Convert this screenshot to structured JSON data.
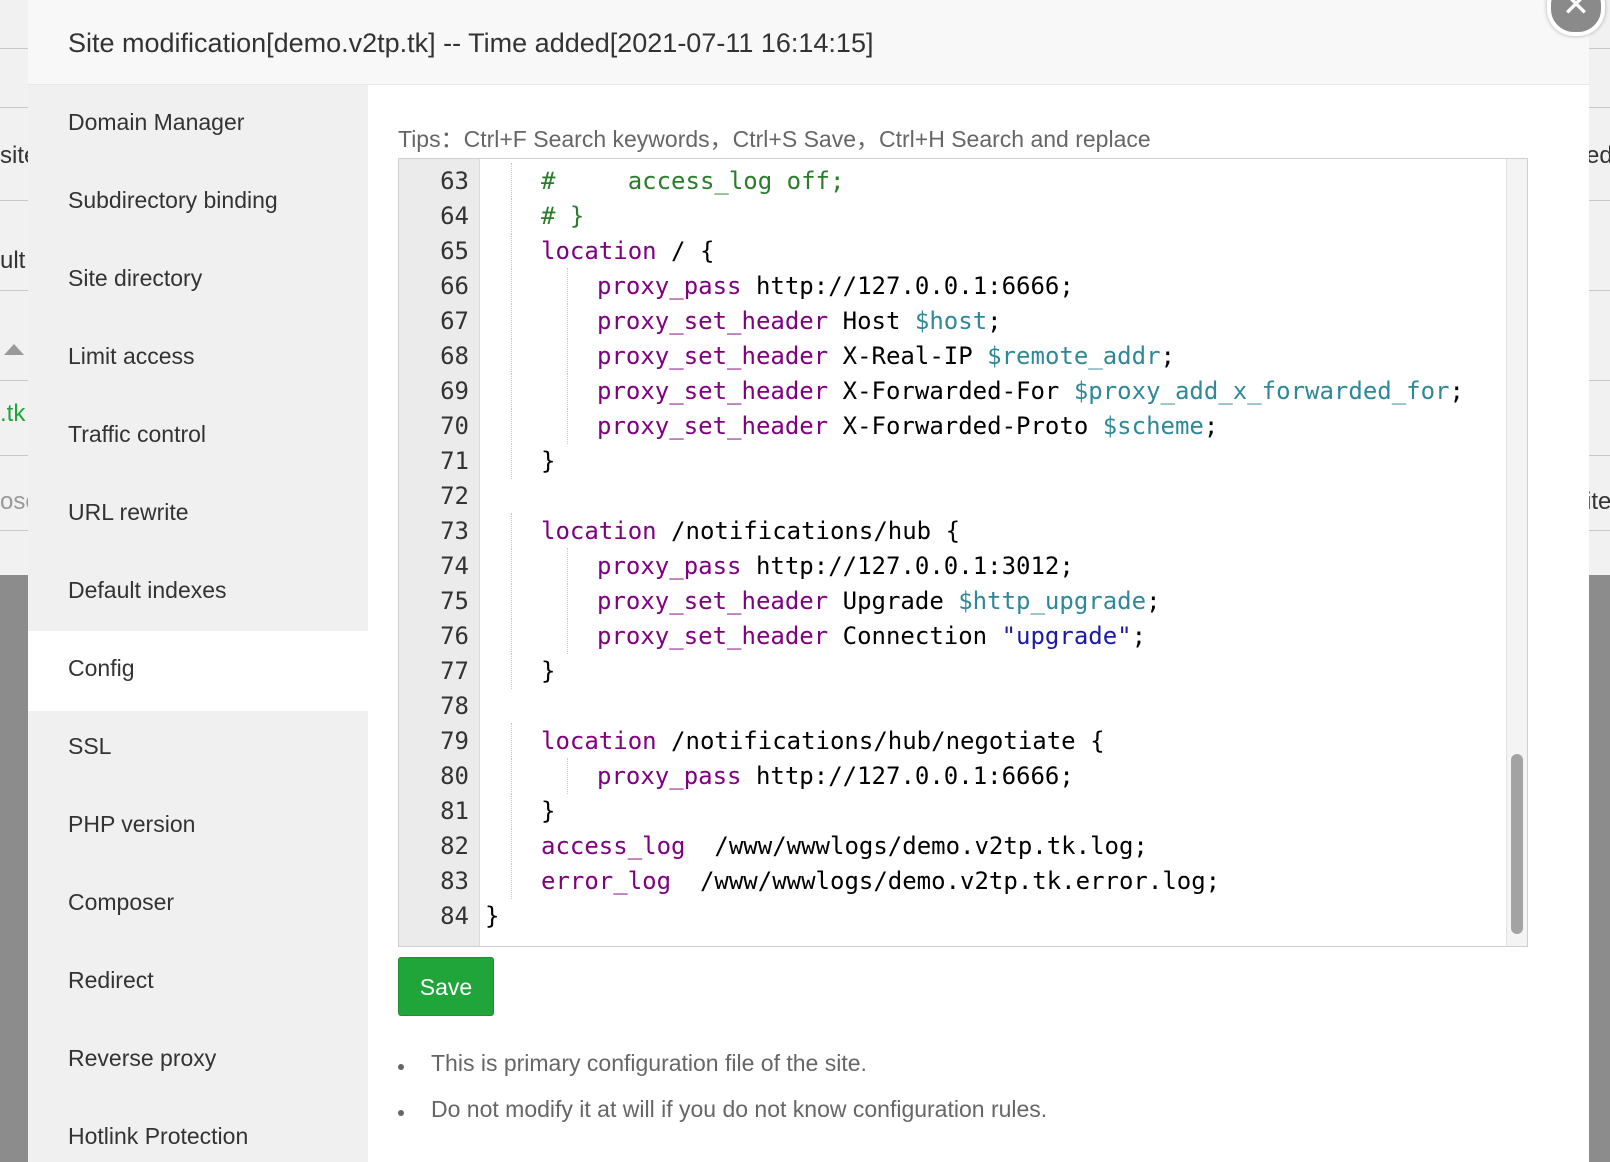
{
  "background": {
    "left_fragments": [
      "site",
      "ult",
      ".tk",
      "ose"
    ],
    "right_fragments": [
      "ed",
      "ite"
    ]
  },
  "modal": {
    "title": "Site modification[demo.v2tp.tk] -- Time added[2021-07-11 16:14:15]",
    "close_icon": "close-icon"
  },
  "sidebar": {
    "items": [
      {
        "label": "Domain Manager"
      },
      {
        "label": "Subdirectory binding"
      },
      {
        "label": "Site directory"
      },
      {
        "label": "Limit access"
      },
      {
        "label": "Traffic control"
      },
      {
        "label": "URL rewrite"
      },
      {
        "label": "Default indexes"
      },
      {
        "label": "Config"
      },
      {
        "label": "SSL"
      },
      {
        "label": "PHP version"
      },
      {
        "label": "Composer"
      },
      {
        "label": "Redirect"
      },
      {
        "label": "Reverse proxy"
      },
      {
        "label": "Hotlink Protection"
      }
    ],
    "active": "Config"
  },
  "tips": "Tips：Ctrl+F Search keywords，Ctrl+S Save，Ctrl+H Search and replace",
  "editor": {
    "lines": [
      {
        "n": "63",
        "indent": 1,
        "tokens": [
          [
            "cm",
            "#     access_log off;"
          ]
        ]
      },
      {
        "n": "64",
        "indent": 1,
        "tokens": [
          [
            "cm",
            "# }"
          ]
        ]
      },
      {
        "n": "65",
        "indent": 1,
        "tokens": [
          [
            "kw",
            "location"
          ],
          [
            "",
            " / {"
          ]
        ]
      },
      {
        "n": "66",
        "indent": 2,
        "tokens": [
          [
            "kw",
            "proxy_pass"
          ],
          [
            "",
            " http://127.0.0.1:6666;"
          ]
        ]
      },
      {
        "n": "67",
        "indent": 2,
        "tokens": [
          [
            "kw",
            "proxy_set_header"
          ],
          [
            "",
            " Host "
          ],
          [
            "var",
            "$host"
          ],
          [
            "",
            ";"
          ]
        ]
      },
      {
        "n": "68",
        "indent": 2,
        "tokens": [
          [
            "kw",
            "proxy_set_header"
          ],
          [
            "",
            " X-Real-IP "
          ],
          [
            "var",
            "$remote_addr"
          ],
          [
            "",
            ";"
          ]
        ]
      },
      {
        "n": "69",
        "indent": 2,
        "tokens": [
          [
            "kw",
            "proxy_set_header"
          ],
          [
            "",
            " X-Forwarded-For "
          ],
          [
            "var",
            "$proxy_add_x_forwarded_for"
          ],
          [
            "",
            ";"
          ]
        ]
      },
      {
        "n": "70",
        "indent": 2,
        "tokens": [
          [
            "kw",
            "proxy_set_header"
          ],
          [
            "",
            " X-Forwarded-Proto "
          ],
          [
            "var",
            "$scheme"
          ],
          [
            "",
            ";"
          ]
        ]
      },
      {
        "n": "71",
        "indent": 1,
        "tokens": [
          [
            "",
            "}"
          ]
        ]
      },
      {
        "n": "72",
        "indent": 0,
        "tokens": []
      },
      {
        "n": "73",
        "indent": 1,
        "tokens": [
          [
            "kw",
            "location"
          ],
          [
            "",
            " /notifications/hub {"
          ]
        ]
      },
      {
        "n": "74",
        "indent": 2,
        "tokens": [
          [
            "kw",
            "proxy_pass"
          ],
          [
            "",
            " http://127.0.0.1:3012;"
          ]
        ]
      },
      {
        "n": "75",
        "indent": 2,
        "tokens": [
          [
            "kw",
            "proxy_set_header"
          ],
          [
            "",
            " Upgrade "
          ],
          [
            "var",
            "$http_upgrade"
          ],
          [
            "",
            ";"
          ]
        ]
      },
      {
        "n": "76",
        "indent": 2,
        "tokens": [
          [
            "kw",
            "proxy_set_header"
          ],
          [
            "",
            " Connection "
          ],
          [
            "str",
            "\"upgrade\""
          ],
          [
            "",
            ";"
          ]
        ]
      },
      {
        "n": "77",
        "indent": 1,
        "tokens": [
          [
            "",
            "}"
          ]
        ]
      },
      {
        "n": "78",
        "indent": 0,
        "tokens": []
      },
      {
        "n": "79",
        "indent": 1,
        "tokens": [
          [
            "kw",
            "location"
          ],
          [
            "",
            " /notifications/hub/negotiate {"
          ]
        ]
      },
      {
        "n": "80",
        "indent": 2,
        "tokens": [
          [
            "kw",
            "proxy_pass"
          ],
          [
            "",
            " http://127.0.0.1:6666;"
          ]
        ]
      },
      {
        "n": "81",
        "indent": 1,
        "tokens": [
          [
            "",
            "}"
          ]
        ]
      },
      {
        "n": "82",
        "indent": 1,
        "tokens": [
          [
            "kw",
            "access_log"
          ],
          [
            "",
            "  /www/wwwlogs/demo.v2tp.tk.log;"
          ]
        ]
      },
      {
        "n": "83",
        "indent": 1,
        "tokens": [
          [
            "kw",
            "error_log"
          ],
          [
            "",
            "  /www/wwwlogs/demo.v2tp.tk.error.log;"
          ]
        ]
      },
      {
        "n": "84",
        "indent": 0,
        "tokens": [
          [
            "",
            "}"
          ]
        ]
      }
    ]
  },
  "save_label": "Save",
  "notes": [
    "This is primary configuration file of the site.",
    "Do not modify it at will if you do not know configuration rules."
  ],
  "colors": {
    "accent": "#20a53a",
    "keyword": "#800080",
    "variable": "#2f8898",
    "comment": "#2a7d2a",
    "string": "#1a1aa6"
  }
}
